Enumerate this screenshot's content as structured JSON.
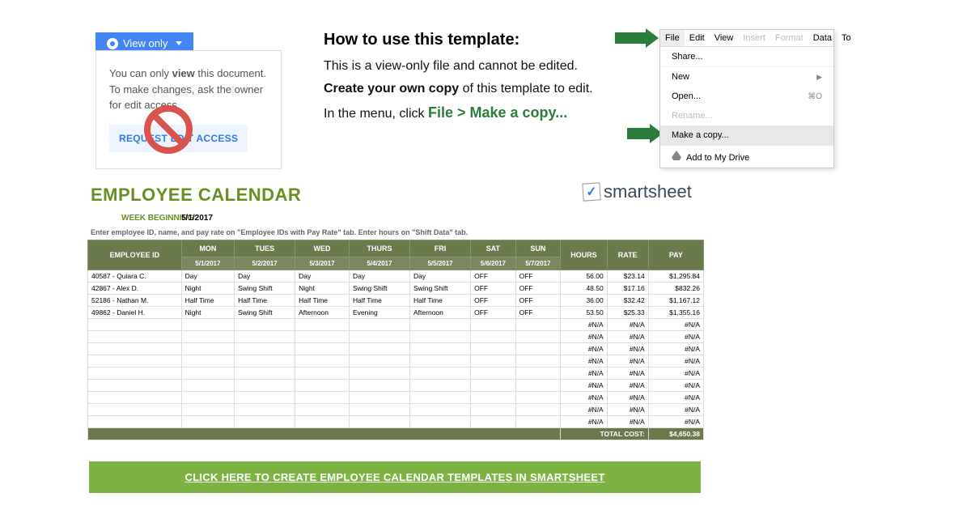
{
  "viewOnly": {
    "button": "View only",
    "info1_pre": "You can only ",
    "info1_bold": "view",
    "info1_post": " this document.",
    "info2": "To make changes, ask the owner for edit access.",
    "request": "REQUEST EDIT ACCESS"
  },
  "instructions": {
    "title": "How to use this template:",
    "line1": "This is a view-only file and cannot be edited.",
    "line2_bold": "Create your own copy",
    "line2_rest": " of this template to edit.",
    "line3_pre": "In the menu, click ",
    "line3_path": "File > Make a copy..."
  },
  "menuBar": [
    "File",
    "Edit",
    "View",
    "Insert",
    "Format",
    "Data",
    "To"
  ],
  "fileMenu": {
    "share": "Share...",
    "new": "New",
    "open": "Open...",
    "open_shortcut": "⌘O",
    "rename": "Rename...",
    "makeCopy": "Make a copy...",
    "addDrive": "Add to My Drive"
  },
  "logo": {
    "brand": "smartsheet"
  },
  "sheet": {
    "title": "EMPLOYEE CALENDAR",
    "weekLabel": "WEEK BEGINNING:",
    "weekDate": "5/1/2017",
    "help": "Enter employee ID, name, and pay rate on \"Employee IDs with Pay Rate\" tab. Enter hours on \"Shift Data\" tab.",
    "headers": {
      "empId": "EMPLOYEE ID",
      "mon": "MON",
      "tue": "TUES",
      "wed": "WED",
      "thu": "THURS",
      "fri": "FRI",
      "sat": "SAT",
      "sun": "SUN",
      "hours": "HOURS",
      "rate": "RATE",
      "pay": "PAY"
    },
    "dates": [
      "5/1/2017",
      "5/2/2017",
      "5/3/2017",
      "5/4/2017",
      "5/5/2017",
      "5/6/2017",
      "5/7/2017"
    ],
    "rows": [
      {
        "id": "40587 - Quiara C.",
        "d": [
          "Day",
          "Day",
          "Day",
          "Day",
          "Day",
          "OFF",
          "OFF"
        ],
        "hours": "56.00",
        "rate": "$23.14",
        "pay": "$1,295.84"
      },
      {
        "id": "42867 - Alex D.",
        "d": [
          "Night",
          "Swing Shift",
          "Night",
          "Swing Shift",
          "Swing Shift",
          "OFF",
          "OFF"
        ],
        "hours": "48.50",
        "rate": "$17.16",
        "pay": "$832.26"
      },
      {
        "id": "52186 - Nathan M.",
        "d": [
          "Half Time",
          "Half Time",
          "Half Time",
          "Half Time",
          "Half Time",
          "OFF",
          "OFF"
        ],
        "hours": "36.00",
        "rate": "$32.42",
        "pay": "$1,167.12"
      },
      {
        "id": "49862 - Daniel H.",
        "d": [
          "Night",
          "Swing Shift",
          "Afternoon",
          "Evening",
          "Afternoon",
          "OFF",
          "OFF"
        ],
        "hours": "53.50",
        "rate": "$25.33",
        "pay": "$1,355.16"
      }
    ],
    "na_rows": 9,
    "na": "#N/A",
    "totalLabel": "TOTAL COST:",
    "totalValue": "$4,650.38"
  },
  "cta": "CLICK HERE TO CREATE EMPLOYEE CALENDAR TEMPLATES IN SMARTSHEET"
}
